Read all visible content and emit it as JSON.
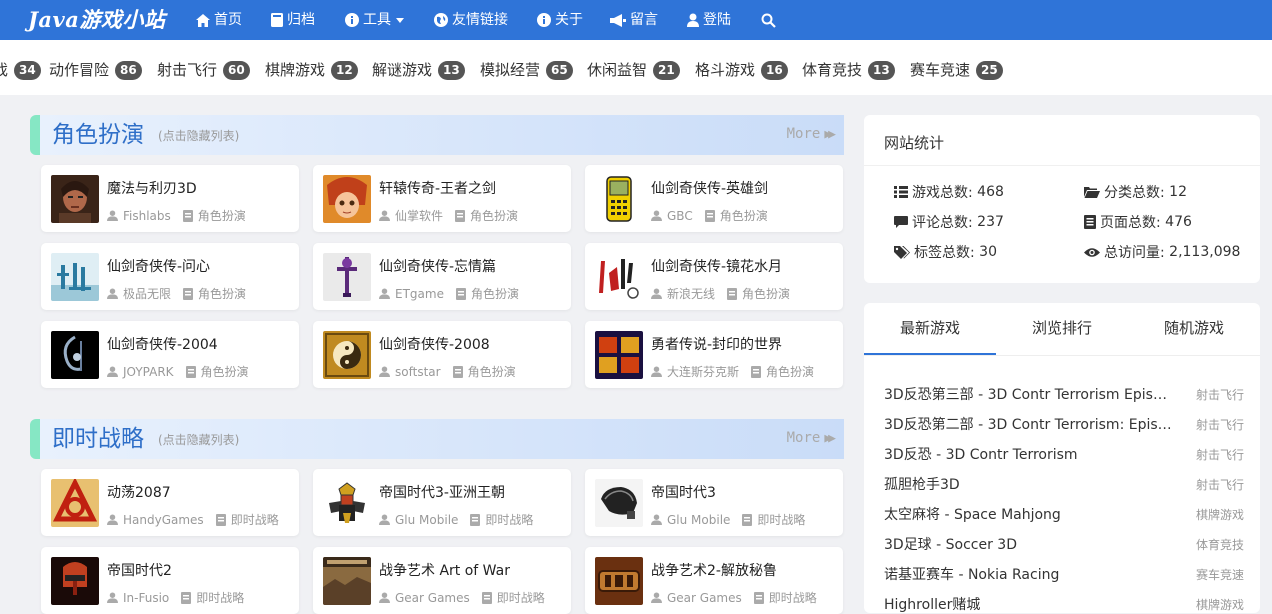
{
  "nav": {
    "brand": "Java游戏小站",
    "items": [
      "首页",
      "归档",
      "工具",
      "友情链接",
      "关于",
      "留言",
      "登陆"
    ]
  },
  "categories": [
    {
      "name": "戏",
      "count": "34"
    },
    {
      "name": "动作冒险",
      "count": "86"
    },
    {
      "name": "射击飞行",
      "count": "60"
    },
    {
      "name": "棋牌游戏",
      "count": "12"
    },
    {
      "name": "解谜游戏",
      "count": "13"
    },
    {
      "name": "模拟经营",
      "count": "65"
    },
    {
      "name": "休闲益智",
      "count": "21"
    },
    {
      "name": "格斗游戏",
      "count": "16"
    },
    {
      "name": "体育竞技",
      "count": "13"
    },
    {
      "name": "赛车竞速",
      "count": "25"
    }
  ],
  "sections": [
    {
      "title": "角色扮演",
      "hint": "(点击隐藏列表)",
      "more": "More",
      "games": [
        {
          "title": "魔法与利刃3D",
          "author": "Fishlabs",
          "category": "角色扮演"
        },
        {
          "title": "轩辕传奇-王者之剑",
          "author": "仙掌软件",
          "category": "角色扮演"
        },
        {
          "title": "仙剑奇侠传-英雄剑",
          "author": "GBC",
          "category": "角色扮演"
        },
        {
          "title": "仙剑奇侠传-问心",
          "author": "极品无限",
          "category": "角色扮演"
        },
        {
          "title": "仙剑奇侠传-忘情篇",
          "author": "ETgame",
          "category": "角色扮演"
        },
        {
          "title": "仙剑奇侠传-镜花水月",
          "author": "新浪无线",
          "category": "角色扮演"
        },
        {
          "title": "仙剑奇侠传-2004",
          "author": "JOYPARK",
          "category": "角色扮演"
        },
        {
          "title": "仙剑奇侠传-2008",
          "author": "softstar",
          "category": "角色扮演"
        },
        {
          "title": "勇者传说-封印的世界",
          "author": "大连斯芬克斯",
          "category": "角色扮演"
        }
      ]
    },
    {
      "title": "即时战略",
      "hint": "(点击隐藏列表)",
      "more": "More",
      "games": [
        {
          "title": "动荡2087",
          "author": "HandyGames",
          "category": "即时战略"
        },
        {
          "title": "帝国时代3-亚洲王朝",
          "author": "Glu Mobile",
          "category": "即时战略"
        },
        {
          "title": "帝国时代3",
          "author": "Glu Mobile",
          "category": "即时战略"
        },
        {
          "title": "帝国时代2",
          "author": "In-Fusio",
          "category": "即时战略"
        },
        {
          "title": "战争艺术 Art of War",
          "author": "Gear Games",
          "category": "即时战略"
        },
        {
          "title": "战争艺术2-解放秘鲁",
          "author": "Gear Games",
          "category": "即时战略"
        }
      ]
    }
  ],
  "stats": {
    "title": "网站统计",
    "items": [
      {
        "label": "游戏总数:",
        "value": "468"
      },
      {
        "label": "分类总数:",
        "value": "12"
      },
      {
        "label": "评论总数:",
        "value": "237"
      },
      {
        "label": "页面总数:",
        "value": "476"
      },
      {
        "label": "标签总数:",
        "value": "30"
      },
      {
        "label": "总访问量:",
        "value": "2,113,098"
      }
    ]
  },
  "tabs": [
    "最新游戏",
    "浏览排行",
    "随机游戏"
  ],
  "latest": [
    {
      "title": "3D反恐第三部 - 3D Contr Terrorism Episo...",
      "category": "射击飞行"
    },
    {
      "title": "3D反恐第二部 - 3D Contr Terrorism: Episo...",
      "category": "射击飞行"
    },
    {
      "title": "3D反恐 - 3D Contr Terrorism",
      "category": "射击飞行"
    },
    {
      "title": "孤胆枪手3D",
      "category": "射击飞行"
    },
    {
      "title": "太空麻将 - Space Mahjong",
      "category": "棋牌游戏"
    },
    {
      "title": "3D足球 - Soccer 3D",
      "category": "体育竞技"
    },
    {
      "title": "诺基亚赛车 - Nokia Racing",
      "category": "赛车竞速"
    },
    {
      "title": "Highroller赌城",
      "category": "棋牌游戏"
    }
  ]
}
